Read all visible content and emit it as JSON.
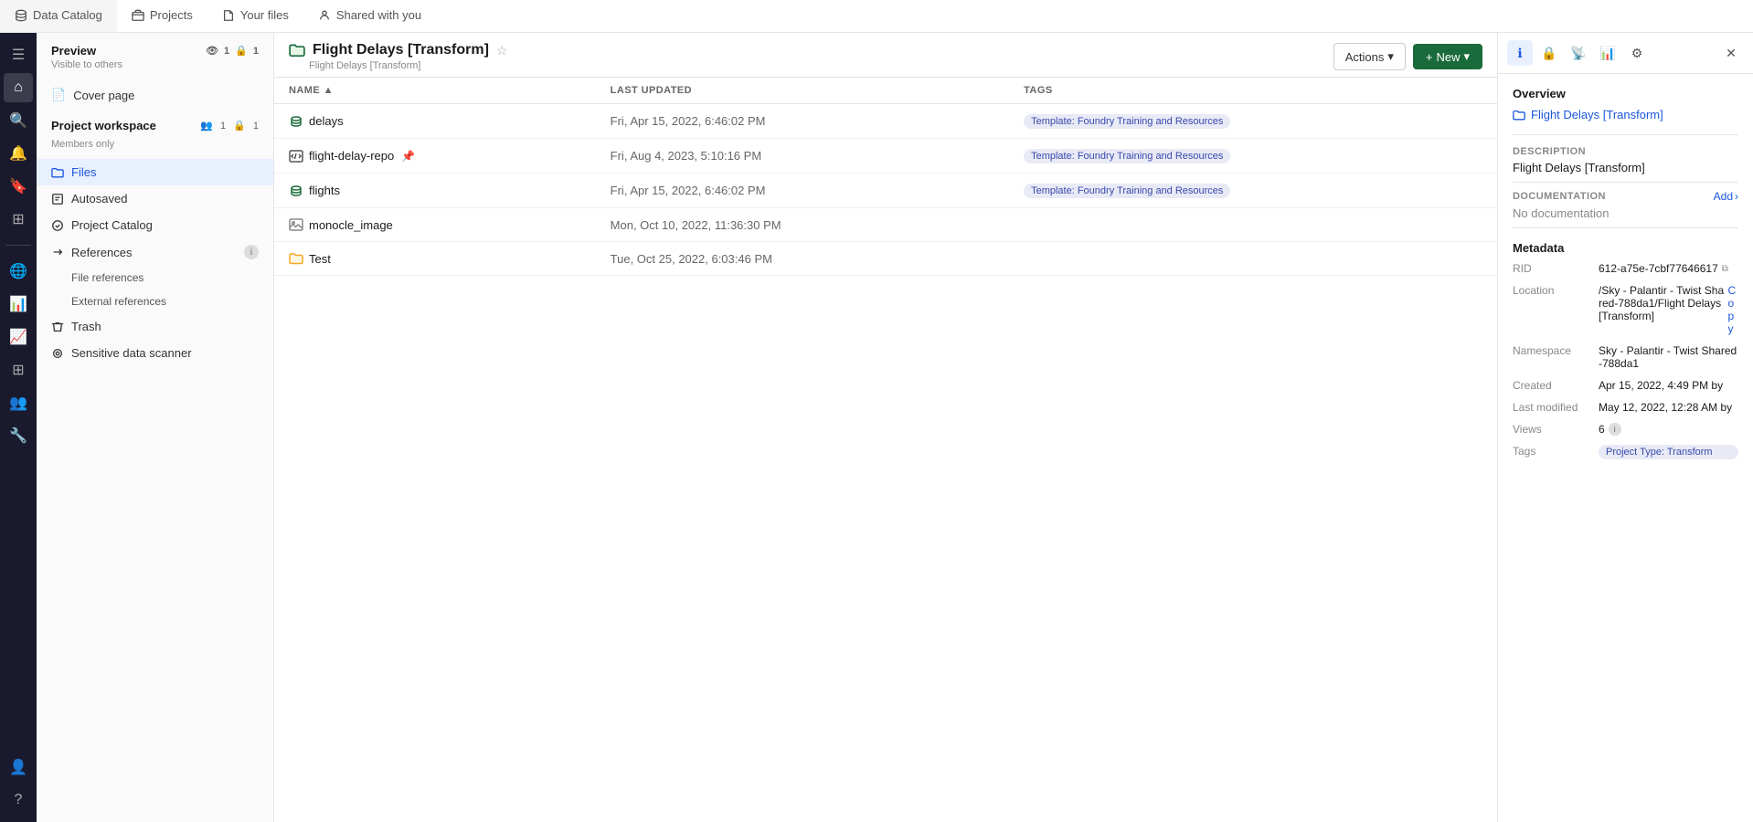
{
  "topNav": {
    "tabs": [
      {
        "id": "data-catalog",
        "label": "Data Catalog",
        "icon": "database",
        "active": false
      },
      {
        "id": "projects",
        "label": "Projects",
        "icon": "folder",
        "active": false
      },
      {
        "id": "your-files",
        "label": "Your files",
        "icon": "file",
        "active": false
      },
      {
        "id": "shared-with-you",
        "label": "Shared with you",
        "icon": "user",
        "active": false
      }
    ]
  },
  "pageHeader": {
    "icon": "folder",
    "title": "Flight Delays [Transform]",
    "breadcrumb": "Flight Delays [Transform]",
    "actionsLabel": "Actions",
    "newLabel": "New"
  },
  "sidebar": {
    "preview": {
      "title": "Preview",
      "subtitle": "Visible to others",
      "eyeIcon": "👁",
      "countA": "1",
      "countB": "1"
    },
    "coverPage": "Cover page",
    "projectWorkspace": {
      "title": "Project workspace",
      "subtitle": "Members only",
      "countA": "1",
      "countB": "1"
    },
    "items": [
      {
        "id": "files",
        "label": "Files",
        "icon": "folder",
        "active": true
      },
      {
        "id": "autosaved",
        "label": "Autosaved",
        "icon": "file-text",
        "active": false
      },
      {
        "id": "project-catalog",
        "label": "Project Catalog",
        "icon": "check-circle",
        "active": false
      }
    ],
    "references": {
      "label": "References",
      "showInfo": true,
      "subItems": [
        {
          "id": "file-references",
          "label": "File references"
        },
        {
          "id": "external-references",
          "label": "External references"
        }
      ]
    },
    "trash": "Trash",
    "sensitiveDataScanner": "Sensitive data scanner"
  },
  "table": {
    "columns": [
      {
        "id": "name",
        "label": "Name",
        "sortable": true
      },
      {
        "id": "last-updated",
        "label": "Last Updated",
        "sortable": false
      },
      {
        "id": "tags",
        "label": "Tags",
        "sortable": false
      }
    ],
    "rows": [
      {
        "id": 1,
        "name": "delays",
        "icon": "dataset-blue",
        "lastUpdated": "Fri, Apr 15, 2022, 6:46:02 PM",
        "tag": "Template: Foundry Training and Resources",
        "hasPin": false
      },
      {
        "id": 2,
        "name": "flight-delay-repo",
        "icon": "code-repo",
        "lastUpdated": "Fri, Aug 4, 2023, 5:10:16 PM",
        "tag": "Template: Foundry Training and Resources",
        "hasPin": true
      },
      {
        "id": 3,
        "name": "flights",
        "icon": "dataset-blue",
        "lastUpdated": "Fri, Apr 15, 2022, 6:46:02 PM",
        "tag": "Template: Foundry Training and Resources",
        "hasPin": false
      },
      {
        "id": 4,
        "name": "monocle_image",
        "icon": "image",
        "lastUpdated": "Mon, Oct 10, 2022, 11:36:30 PM",
        "tag": "",
        "hasPin": false
      },
      {
        "id": 5,
        "name": "Test",
        "icon": "folder-yellow",
        "lastUpdated": "Tue, Oct 25, 2022, 6:03:46 PM",
        "tag": "",
        "hasPin": false
      }
    ]
  },
  "rightPanel": {
    "overview": "Overview",
    "projectTitle": "Flight Delays [Transform]",
    "description": {
      "label": "Description",
      "value": "Flight Delays [Transform]"
    },
    "documentation": {
      "label": "Documentation",
      "addLabel": "Add",
      "noDocText": "No documentation"
    },
    "metadata": {
      "title": "Metadata",
      "rid": {
        "key": "RID",
        "value": "612-a75e-7cbf77646617"
      },
      "location": {
        "key": "Location",
        "value": "/Sky - Palantir - Twist Shared-788da1/Flight Delays [Transform]",
        "copyLabel": "Copy"
      },
      "namespace": {
        "key": "Namespace",
        "value": "Sky - Palantir - Twist Shared-788da1"
      },
      "created": {
        "key": "Created",
        "value": "Apr 15, 2022, 4:49 PM by"
      },
      "lastModified": {
        "key": "Last modified",
        "value": "May 12, 2022, 12:28 AM by"
      },
      "views": {
        "key": "Views",
        "value": "6"
      },
      "tags": {
        "key": "Tags",
        "value": "Project Type: Transform"
      }
    }
  }
}
